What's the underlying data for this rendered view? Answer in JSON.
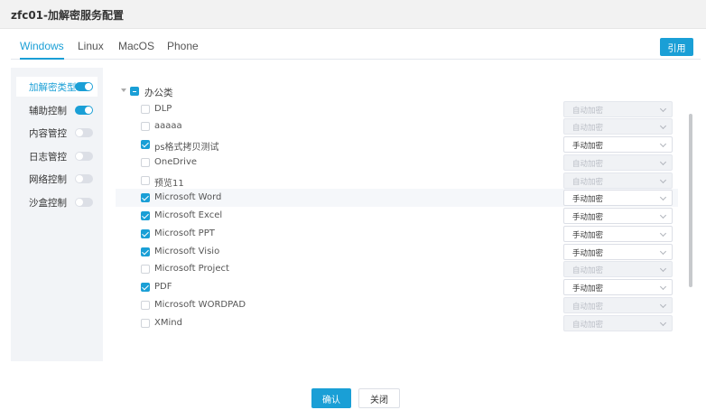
{
  "window": {
    "title": "zfc01-加解密服务配置"
  },
  "tabs": [
    {
      "label": "Windows",
      "active": true
    },
    {
      "label": "Linux",
      "active": false
    },
    {
      "label": "MacOS",
      "active": false
    },
    {
      "label": "Phone",
      "active": false
    }
  ],
  "apply_label": "引用",
  "sidebar": {
    "items": [
      {
        "label": "加解密类型",
        "enabled": true,
        "active": true
      },
      {
        "label": "辅助控制",
        "enabled": true,
        "active": false
      },
      {
        "label": "内容管控",
        "enabled": false,
        "active": false
      },
      {
        "label": "日志管控",
        "enabled": false,
        "active": false
      },
      {
        "label": "网络控制",
        "enabled": false,
        "active": false
      },
      {
        "label": "沙盒控制",
        "enabled": false,
        "active": false
      }
    ]
  },
  "tree": {
    "root": {
      "label": "办公类",
      "state": "indeterminate",
      "expanded": true
    },
    "items": [
      {
        "name": "DLP",
        "checked": false,
        "mode": "自动加密",
        "disabled": true
      },
      {
        "name": "aaaaa",
        "checked": false,
        "mode": "自动加密",
        "disabled": true
      },
      {
        "name": "ps格式拷贝测试",
        "checked": true,
        "mode": "手动加密",
        "disabled": false
      },
      {
        "name": "OneDrive",
        "checked": false,
        "mode": "自动加密",
        "disabled": true
      },
      {
        "name": "预览11",
        "checked": false,
        "mode": "自动加密",
        "disabled": true
      },
      {
        "name": "Microsoft Word",
        "checked": true,
        "mode": "手动加密",
        "disabled": false,
        "hover": true
      },
      {
        "name": "Microsoft Excel",
        "checked": true,
        "mode": "手动加密",
        "disabled": false
      },
      {
        "name": "Microsoft PPT",
        "checked": true,
        "mode": "手动加密",
        "disabled": false
      },
      {
        "name": "Microsoft Visio",
        "checked": true,
        "mode": "手动加密",
        "disabled": false
      },
      {
        "name": "Microsoft Project",
        "checked": false,
        "mode": "自动加密",
        "disabled": true
      },
      {
        "name": "PDF",
        "checked": true,
        "mode": "手动加密",
        "disabled": false
      },
      {
        "name": "Microsoft WORDPAD",
        "checked": false,
        "mode": "自动加密",
        "disabled": true
      },
      {
        "name": "XMind",
        "checked": false,
        "mode": "自动加密",
        "disabled": true
      }
    ]
  },
  "footer": {
    "confirm_label": "确认",
    "close_label": "关闭"
  },
  "colors": {
    "accent": "#1a9fd6",
    "sidebar_bg": "#f2f4f7",
    "title_bg": "#f2f2f2"
  }
}
